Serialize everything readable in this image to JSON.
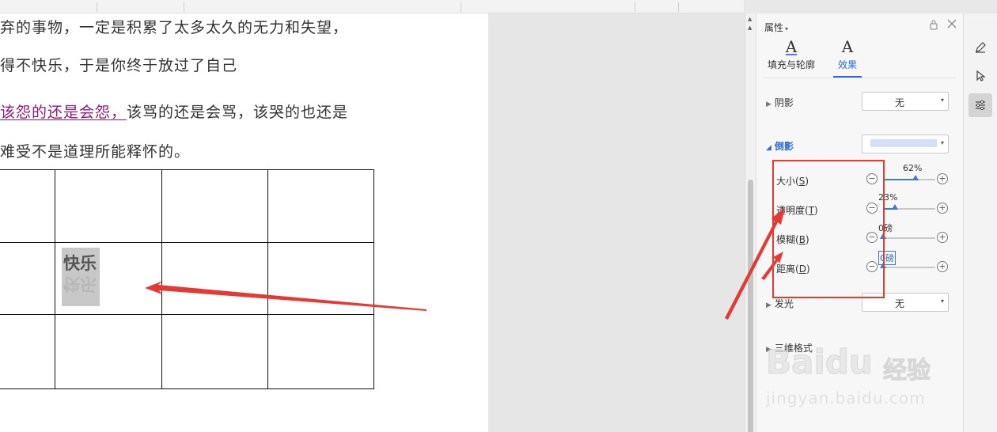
{
  "document": {
    "lines": [
      "弃的事物，一定是积累了太多太久的无力和失望，",
      "得不快乐，于是你终于放过了自己"
    ],
    "line3_underlined": "该怨的还是会怨，",
    "line3_rest": "该骂的还是会骂，该哭的也还是",
    "line4": "难受不是道理所能释怀的。",
    "table_cell_text": "快乐"
  },
  "panel": {
    "title": "属性",
    "tabs": [
      {
        "glyph": "A",
        "label": "填充与轮廓"
      },
      {
        "glyph": "A",
        "label": "效果"
      }
    ],
    "active_tab": "效果",
    "sections": {
      "shadow": {
        "label": "阴影",
        "value": "无"
      },
      "reflection": {
        "label": "倒影"
      },
      "glow": {
        "label": "发光",
        "value": "无"
      },
      "three_d": {
        "label": "三维格式"
      }
    },
    "sliders": [
      {
        "label": "大小",
        "key": "S",
        "value_text": "62%",
        "value": 0.62
      },
      {
        "label": "透明度",
        "key": "T",
        "value_text": "23%",
        "value": 0.23
      },
      {
        "label": "模糊",
        "key": "B",
        "value_text": "0磅",
        "value": 0
      },
      {
        "label": "距离",
        "key": "D",
        "value_text": "0磅",
        "value": 0
      }
    ]
  },
  "colors": {
    "accent": "#2d6cc9",
    "annotation": "#e53935",
    "reflection_swatch": "#d5e0f5"
  },
  "watermark": {
    "brand": "Baidu",
    "brand_cn": "经验",
    "url": "jingyan.baidu.com"
  }
}
